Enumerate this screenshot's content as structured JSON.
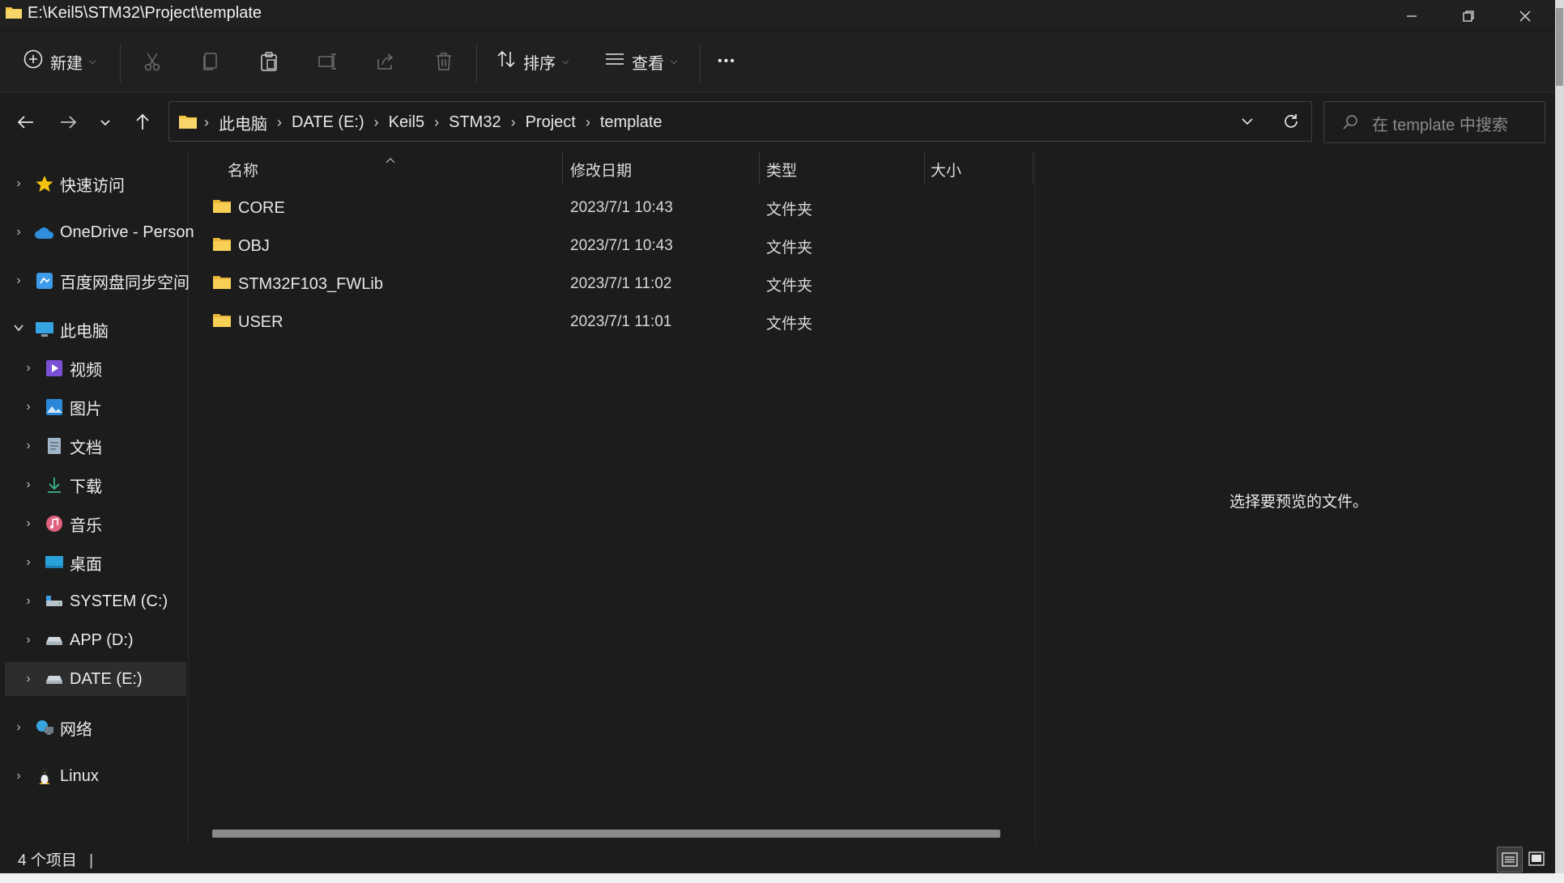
{
  "window": {
    "title": "E:\\Keil5\\STM32\\Project\\template",
    "accent_folder_color": "#f4c542"
  },
  "toolbar": {
    "new_label": "新建",
    "sort_label": "排序",
    "view_label": "查看",
    "more_label": "•••"
  },
  "address": {
    "crumbs": [
      "此电脑",
      "DATE (E:)",
      "Keil5",
      "STM32",
      "Project",
      "template"
    ]
  },
  "search": {
    "placeholder": "在 template 中搜索"
  },
  "sidebar": {
    "items": [
      {
        "label": "快速访问",
        "icon": "star-icon"
      },
      {
        "label": "OneDrive - Person",
        "icon": "cloud-icon"
      },
      {
        "label": "百度网盘同步空间",
        "icon": "baidu-sync-icon"
      },
      {
        "label": "此电脑",
        "icon": "computer-icon"
      },
      {
        "label": "视频",
        "icon": "video-icon"
      },
      {
        "label": "图片",
        "icon": "picture-icon"
      },
      {
        "label": "文档",
        "icon": "document-icon"
      },
      {
        "label": "下载",
        "icon": "download-icon"
      },
      {
        "label": "音乐",
        "icon": "music-icon"
      },
      {
        "label": "桌面",
        "icon": "desktop-icon"
      },
      {
        "label": "SYSTEM (C:)",
        "icon": "system-drive-icon"
      },
      {
        "label": "APP (D:)",
        "icon": "drive-icon"
      },
      {
        "label": "DATE (E:)",
        "icon": "drive-icon"
      },
      {
        "label": "网络",
        "icon": "network-icon"
      },
      {
        "label": "Linux",
        "icon": "linux-penguin-icon"
      }
    ]
  },
  "filelist": {
    "columns": {
      "name": "名称",
      "modified": "修改日期",
      "type": "类型",
      "size": "大小"
    },
    "rows": [
      {
        "name": "CORE",
        "modified": "2023/7/1 10:43",
        "type": "文件夹"
      },
      {
        "name": "OBJ",
        "modified": "2023/7/1 10:43",
        "type": "文件夹"
      },
      {
        "name": "STM32F103_FWLib",
        "modified": "2023/7/1 11:02",
        "type": "文件夹"
      },
      {
        "name": "USER",
        "modified": "2023/7/1 11:01",
        "type": "文件夹"
      }
    ]
  },
  "preview": {
    "message": "选择要预览的文件。"
  },
  "status": {
    "count_text": "4 个项目"
  }
}
